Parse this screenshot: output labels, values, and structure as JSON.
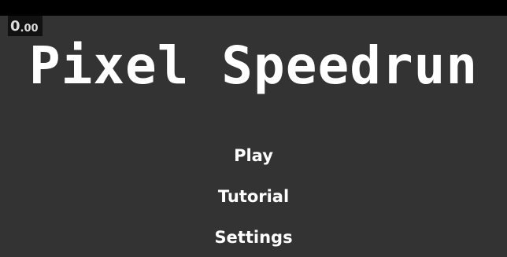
{
  "hud": {
    "timer_int": "0",
    "timer_frac": ".00"
  },
  "title": "Pixel Speedrun",
  "menu": {
    "play": "Play",
    "tutorial": "Tutorial",
    "settings": "Settings"
  },
  "colors": {
    "background": "#333333",
    "top_bar": "#000000",
    "text": "#ffffff",
    "timer_bg": "#111111",
    "timer_text": "#dcdcdc"
  }
}
